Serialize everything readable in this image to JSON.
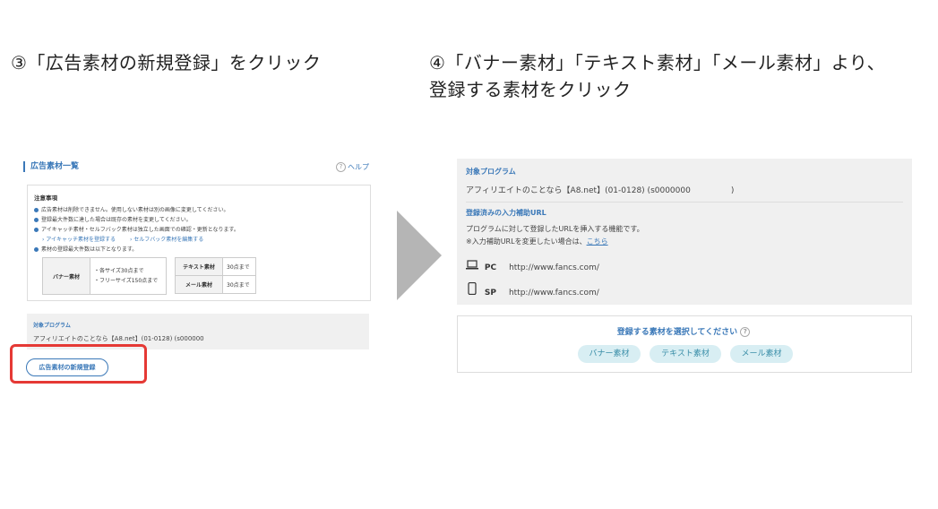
{
  "steps": {
    "step3": "③「広告素材の新規登録」をクリック",
    "step4_line1": "④「バナー素材」「テキスト素材」「メール素材」より、",
    "step4_line2": "登録する素材をクリック"
  },
  "left_panel": {
    "title": "広告素材一覧",
    "help": "ヘルプ",
    "notice_title": "注意事項",
    "notices": [
      "広告素材は削除できません。使用しない素材は別の画像に変更してください。",
      "登録最大件数に達した場合は既存の素材を変更してください。",
      "アイキャッチ素材・セルフバック素材は独立した画面での確認・更新となります。",
      "素材の登録最大件数は以下となります。"
    ],
    "links": [
      "アイキャッチ素材を登録する",
      "セルフバック素材を編集する"
    ],
    "limits": {
      "banner_label": "バナー素材",
      "banner_each": "・各サイズ30点まで",
      "banner_free": "・フリーサイズ150点まで",
      "text_label": "テキスト素材",
      "text_value": "30点まで",
      "mail_label": "メール素材",
      "mail_value": "30点まで"
    },
    "program_label": "対象プログラム",
    "program_value": "アフィリエイトのことなら【A8.net】(01-0128) (s000000",
    "new_button": "広告素材の新規登録"
  },
  "right_panel": {
    "program_label": "対象プログラム",
    "program_value": "アフィリエイトのことなら【A8.net】(01-0128) (s0000000　　　　　)",
    "registered_label": "登録済みの入力補助URL",
    "desc1": "プログラムに対して登録したURLを挿入する機能です。",
    "desc2": "※入力補助URLを変更したい場合は、",
    "desc2_link": "こちら",
    "pc_label": "PC",
    "pc_url": "http://www.fancs.com/",
    "sp_label": "SP",
    "sp_url": "http://www.fancs.com/",
    "select_title": "登録する素材を選択してください",
    "buttons": [
      "バナー素材",
      "テキスト素材",
      "メール素材"
    ]
  }
}
